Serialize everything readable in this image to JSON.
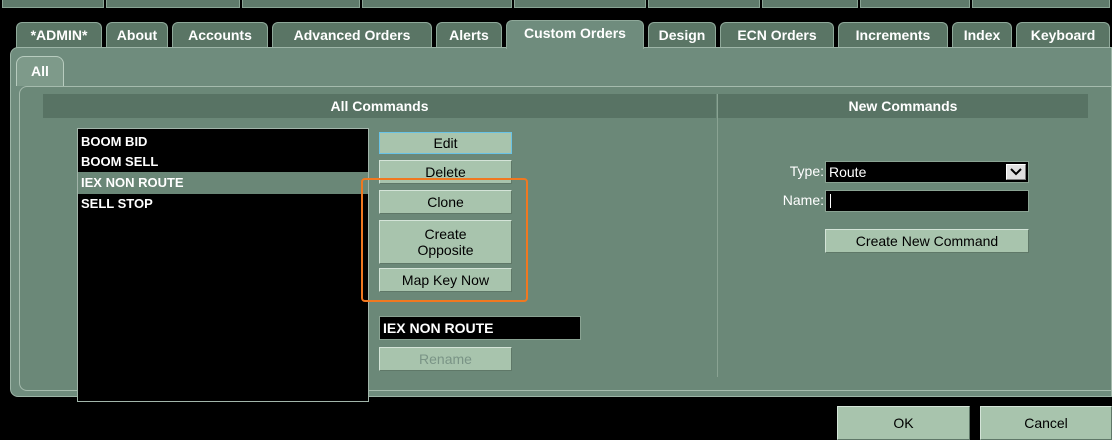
{
  "tabs": [
    "*ADMIN*",
    "About",
    "Accounts",
    "Advanced Orders",
    "Alerts",
    "Custom Orders",
    "Design",
    "ECN Orders",
    "Increments",
    "Index",
    "Keyboard"
  ],
  "active_tab": "Custom Orders",
  "subtab": "All",
  "all_commands": {
    "header": "All Commands",
    "items": [
      "BOOM BID",
      "BOOM SELL",
      "IEX NON ROUTE",
      "SELL STOP"
    ],
    "selected": "IEX NON ROUTE",
    "buttons": {
      "edit": "Edit",
      "delete": "Delete",
      "clone": "Clone",
      "create_opposite_line1": "Create",
      "create_opposite_line2": "Opposite",
      "map_key_now": "Map Key Now",
      "rename": "Rename"
    },
    "name_value": "IEX NON ROUTE"
  },
  "new_commands": {
    "header": "New Commands",
    "type_label": "Type:",
    "type_value": "Route",
    "name_label": "Name:",
    "name_value": "",
    "create_button": "Create New Command"
  },
  "footer": {
    "ok": "OK",
    "cancel": "Cancel"
  },
  "colors": {
    "panel": "#6f8c7d",
    "button": "#a8c4ad",
    "highlight": "#f07820"
  }
}
